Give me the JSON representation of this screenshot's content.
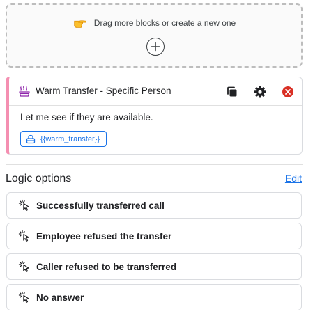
{
  "dropzone": {
    "text": "Drag more blocks or create a new one",
    "hand_icon": "pointing-hand-icon",
    "add_icon": "plus-circle-icon"
  },
  "block": {
    "title": "Warm Transfer - Specific Person",
    "icon": "warm-transfer-icon",
    "message": "Let me see if they are available.",
    "variable": "{{warm_transfer}}",
    "accent_color": "#f48fb1",
    "actions": [
      "copy-icon",
      "gear-icon",
      "close-icon"
    ]
  },
  "logic": {
    "title": "Logic options",
    "edit_label": "Edit",
    "options": [
      {
        "label": "Successfully transferred call",
        "icon": "click-icon"
      },
      {
        "label": "Employee refused the transfer",
        "icon": "click-icon"
      },
      {
        "label": "Caller refused to be transferred",
        "icon": "click-icon"
      },
      {
        "label": "No answer",
        "icon": "click-icon"
      }
    ]
  },
  "colors": {
    "link": "#1a73e8",
    "delete": "#d93025"
  }
}
